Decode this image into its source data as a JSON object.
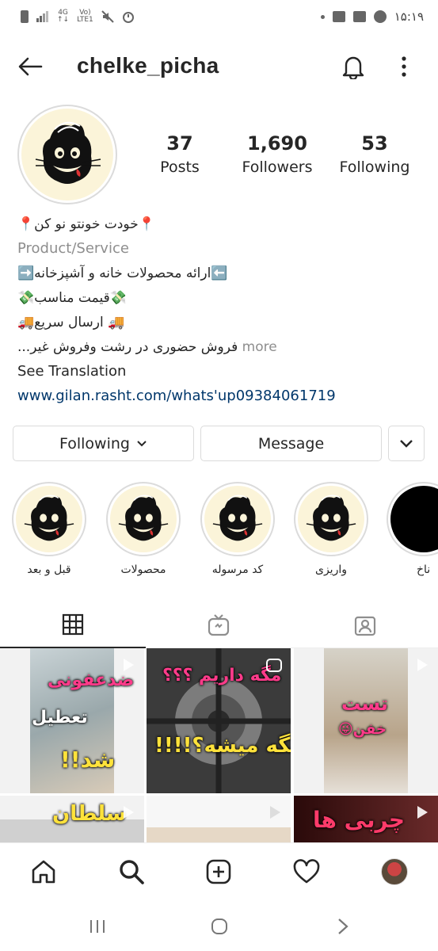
{
  "status_bar": {
    "network_left": "4G",
    "network_sub": "↑↓",
    "volte_top": "Vo)",
    "volte_bottom": "LTE1",
    "time": "۱۵:۱۹"
  },
  "header": {
    "username": "chelke_picha",
    "icons": [
      "back-arrow-icon",
      "bell-icon",
      "more-vertical-icon"
    ]
  },
  "stats": [
    {
      "number": "37",
      "label": "Posts"
    },
    {
      "number": "1,690",
      "label": "Followers"
    },
    {
      "number": "53",
      "label": "Following"
    }
  ],
  "bio": {
    "line1": "📍خودت خونتو نو کن📍",
    "category": "Product/Service",
    "line2": "⬅️ارائه محصولات خانه و آشپزخانه➡️",
    "line3": "💸قیمت مناسب💸",
    "line4": "🚚 ارسال سریع🚚",
    "line5": "فروش حضوری در رشت وفروش غیر...",
    "more": " more",
    "see_translation": "See Translation",
    "link": "www.gilan.rasht.com/whats'up09384061719"
  },
  "buttons": {
    "following": "Following",
    "following_chevron": "⌄",
    "message": "Message"
  },
  "highlights": [
    {
      "label": "قبل و بعد"
    },
    {
      "label": "محصولات"
    },
    {
      "label": "کد مرسوله"
    },
    {
      "label": "واریزی"
    },
    {
      "label": "ناخ"
    }
  ],
  "tabs": [
    "grid-icon",
    "igtv-icon",
    "tagged-icon"
  ],
  "posts": [
    {
      "text_lines": [
        "ضدعفونی",
        "تعطیل",
        "شد!!"
      ]
    },
    {
      "text_lines": [
        "مگه داریم ؟؟؟",
        "مگه میشه؟!!!!"
      ]
    },
    {
      "text_lines": [
        "تست",
        "خفن😜"
      ]
    },
    {
      "text_lines": [
        "سلطان"
      ]
    },
    {
      "text_lines": [
        ""
      ]
    },
    {
      "text_lines": [
        "چربی ها"
      ]
    }
  ],
  "bottom_nav": [
    "home-icon",
    "search-icon",
    "new-post-icon",
    "activity-heart-icon",
    "profile-avatar"
  ],
  "colors": {
    "text": "#262626",
    "secondary": "#8e8e8e",
    "link": "#00376b",
    "border": "#dbdbdb"
  }
}
